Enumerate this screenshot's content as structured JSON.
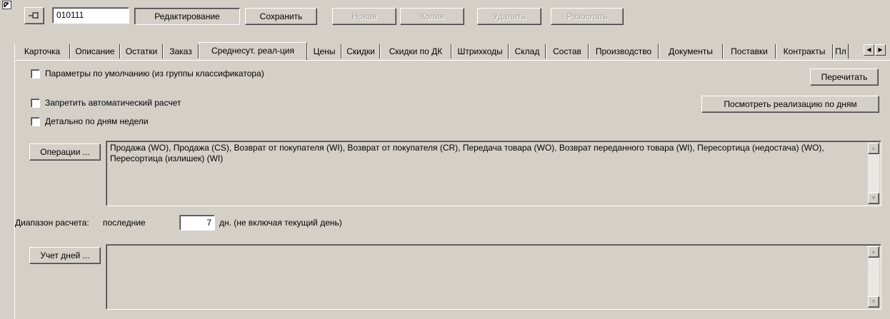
{
  "toolbar": {
    "code_value": "010111",
    "edit_label": "Редактирование",
    "save_label": "Сохранить",
    "new_label": "Новая",
    "copy_label": "Копия",
    "delete_label": "Удалить",
    "send_label": "Разослать"
  },
  "tabs": [
    "Карточка",
    "Описание",
    "Остатки",
    "Заказ",
    "Среднесут. реал-ция",
    "Цены",
    "Скидки",
    "Скидки по ДК",
    "Штрихкоды",
    "Склад",
    "Состав",
    "Производство",
    "Документы",
    "Поставки",
    "Контракты",
    "Пл"
  ],
  "active_tab": "Среднесут. реал-ция",
  "form": {
    "defaults_checkbox": "Параметры по умолчанию (из группы классификатора)",
    "recalc_button": "Перечитать",
    "forbid_auto_checkbox": "Запретить автоматический расчет",
    "by_weekday_checkbox": "Детально по дням недели",
    "view_by_days_button": "Посмотреть реализацию по дням",
    "operations_button": "Операции ...",
    "operations_text": "Продажа (WO), Продажа (CS), Возврат от покупателя (WI), Возврат от покупателя (CR), Передача товара (WO), Возврат переданного товара (WI), Пересортица (недостача) (WO), Пересортица (излишек) (WI)",
    "range_label": "Диапазон расчета:",
    "range_last": "последние",
    "range_value": "7",
    "range_suffix": "дн. (не включая текущий день)",
    "days_button": "Учет дней ...",
    "days_text": ""
  }
}
